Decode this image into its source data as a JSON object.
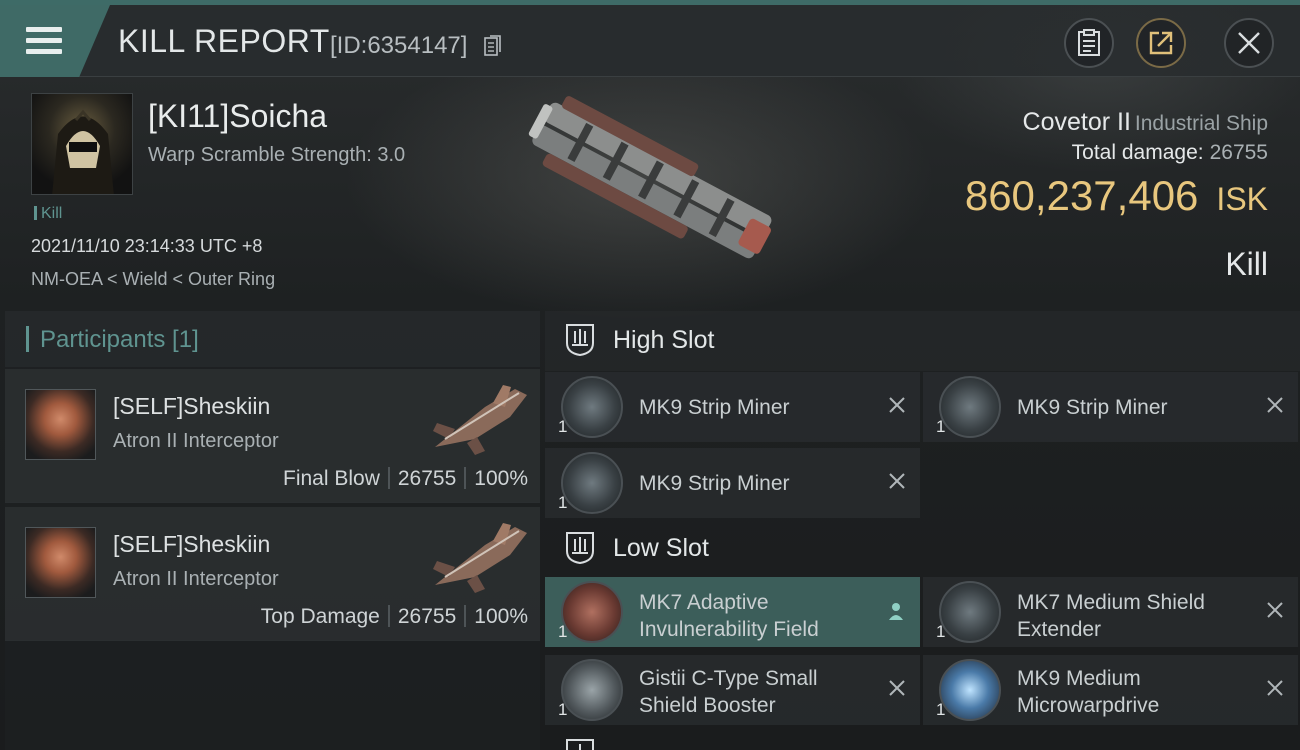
{
  "header": {
    "title": "KILL REPORT",
    "report_id": "[ID:6354147]"
  },
  "victim": {
    "name": "[KI11]Soicha",
    "warp_scramble": "Warp Scramble Strength: 3.0",
    "tag": "Kill",
    "datetime": "2021/11/10 23:14:33 UTC +8",
    "location": "NM-OEA < Wield < Outer Ring",
    "ship_name": "Covetor II",
    "ship_class": "Industrial Ship",
    "total_damage_label": "Total damage:",
    "total_damage_value": "26755",
    "isk_value": "860,237,406",
    "isk_unit": "ISK",
    "result": "Kill"
  },
  "participants": {
    "title": "Participants [1]",
    "rows": [
      {
        "name": "[SELF]Sheskiin",
        "ship": "Atron II Interceptor",
        "role": "Final Blow",
        "damage": "26755",
        "percent": "100%"
      },
      {
        "name": "[SELF]Sheskiin",
        "ship": "Atron II Interceptor",
        "role": "Top Damage",
        "damage": "26755",
        "percent": "100%"
      }
    ]
  },
  "fitting": {
    "high_slot": {
      "title": "High Slot",
      "modules": [
        {
          "qty": "1",
          "line1": "MK9 Strip Miner",
          "line2": ""
        },
        {
          "qty": "1",
          "line1": "MK9 Strip Miner",
          "line2": ""
        },
        {
          "qty": "1",
          "line1": "MK9 Strip Miner",
          "line2": ""
        }
      ]
    },
    "low_slot": {
      "title": "Low Slot",
      "modules": [
        {
          "qty": "1",
          "line1": "MK7 Adaptive",
          "line2": "Invulnerability Field"
        },
        {
          "qty": "1",
          "line1": "MK7 Medium Shield",
          "line2": "Extender"
        },
        {
          "qty": "1",
          "line1": "Gistii C-Type Small",
          "line2": "Shield Booster"
        },
        {
          "qty": "1",
          "line1": "MK9 Medium",
          "line2": "Microwarpdrive"
        }
      ]
    }
  },
  "colors": {
    "accent": "#3f6a66",
    "isk": "#e8c77e",
    "highlight_row": "#3c5e5a"
  },
  "icons": [
    "menu-icon",
    "copy-icon",
    "clipboard-icon",
    "share-icon",
    "close-icon",
    "slot-icon",
    "remove-icon",
    "person-icon"
  ]
}
